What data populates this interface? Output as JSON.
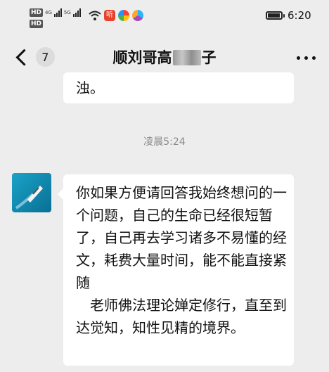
{
  "status_bar": {
    "sim1": "HD",
    "sim2": "HD",
    "net1": "4G",
    "net2": "5G",
    "time": "6:20",
    "battery_level": 0.85,
    "icons": [
      "wifi-icon",
      "listen-app-icon",
      "app-icon-colorful",
      "app-icon-swirl"
    ]
  },
  "nav": {
    "back_count": "7",
    "title_prefix": "顺刘哥高",
    "title_suffix": "子"
  },
  "chat": {
    "previous_message_tail": "浊。",
    "time_separator": "凌晨5:24",
    "message": "你如果方便请回答我始终想问的一个问题，自己的生命已经很短暂了，自己再去学习诸多不易懂的经文，耗费大量时间，能不能直接紧随\n　老师佛法理论婵定修行，直至到达觉知，知性见精的境界。"
  },
  "colors": {
    "background": "#ededed",
    "bubble": "#ffffff",
    "time_text": "#8a8a8a"
  }
}
